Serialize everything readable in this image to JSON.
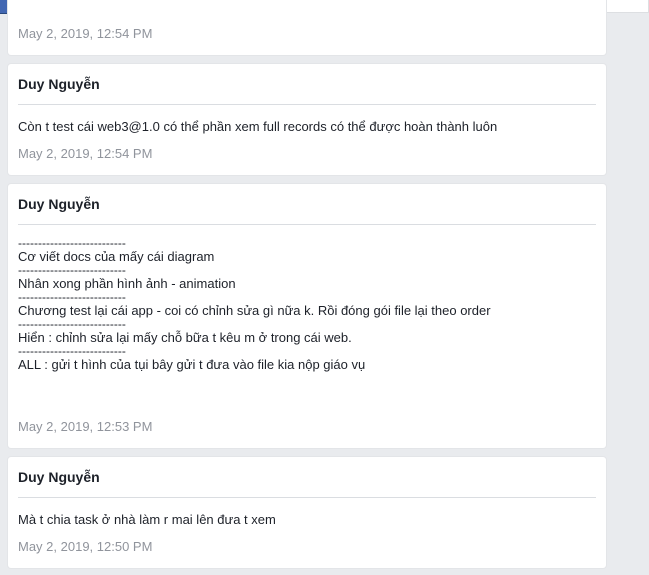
{
  "colors": {
    "topbar": "#4267b2",
    "page_bg": "#e9ebee",
    "card_bg": "#ffffff",
    "timestamp": "#90949c",
    "text": "#1d2129"
  },
  "header": {
    "logo_icon": "facebook-f-icon"
  },
  "posts": [
    {
      "timestamp": "May 2, 2019, 12:54 PM"
    },
    {
      "author": "Duy Nguyễn",
      "lines": [
        "Còn t test cái web3@1.0 có thể phần xem full records có thể được hoàn thành luôn"
      ],
      "timestamp": "May 2, 2019, 12:54 PM"
    },
    {
      "author": "Duy Nguyễn",
      "lines": [
        "---------------------------",
        "Cơ viết docs của mấy cái diagram",
        "---------------------------",
        "Nhân xong phần hình ảnh - animation",
        "---------------------------",
        "Chương test lại cái app - coi có chỉnh sửa gì nữa k. Rồi đóng gói file lại theo order",
        "---------------------------",
        "Hiển : chỉnh sửa lại mấy chỗ bữa t kêu m ở trong cái web.",
        "---------------------------",
        "ALL : gửi t hình của tụi bây gửi t đưa vào file kia nộp giáo vụ"
      ],
      "timestamp": "May 2, 2019, 12:53 PM"
    },
    {
      "author": "Duy Nguyễn",
      "lines": [
        "Mà t chia task ở nhà làm r mai lên đưa t xem"
      ],
      "timestamp": "May 2, 2019, 12:50 PM"
    }
  ]
}
